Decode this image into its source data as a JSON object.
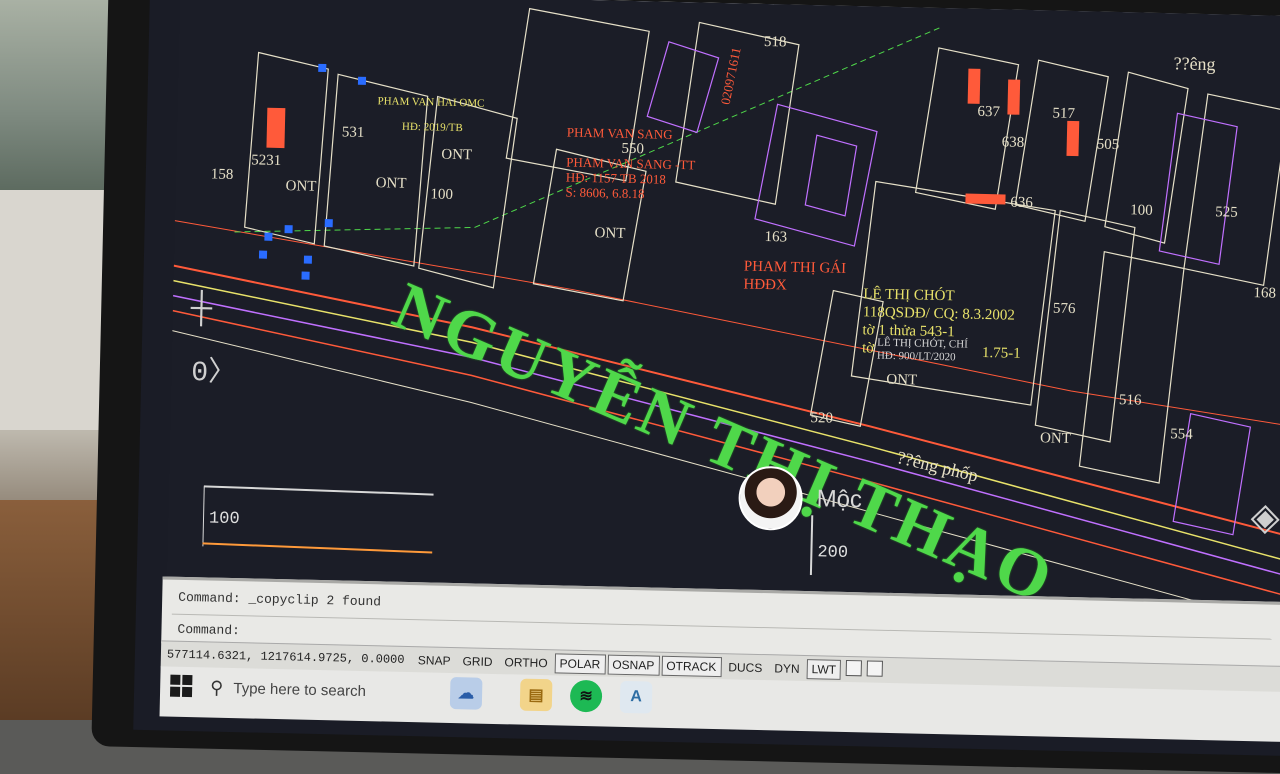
{
  "street_name": "NGUYỄN THỊ THẠO",
  "drawing": {
    "parcels": [
      {
        "id": "p518",
        "text": "518"
      },
      {
        "id": "p531",
        "text": "531"
      },
      {
        "id": "p5231",
        "text": "5231"
      },
      {
        "id": "p158",
        "text": "158"
      },
      {
        "id": "p550",
        "text": "550"
      },
      {
        "id": "p163",
        "text": "163"
      },
      {
        "id": "p576",
        "text": "576"
      },
      {
        "id": "p520",
        "text": "520"
      },
      {
        "id": "p516",
        "text": "516"
      },
      {
        "id": "p554",
        "text": "554"
      },
      {
        "id": "p517",
        "text": "517"
      },
      {
        "id": "p637",
        "text": "637"
      },
      {
        "id": "p638",
        "text": "638"
      },
      {
        "id": "p636",
        "text": "636"
      },
      {
        "id": "p505",
        "text": "505"
      },
      {
        "id": "p525",
        "text": "525"
      },
      {
        "id": "p168",
        "text": "168"
      },
      {
        "id": "p100a",
        "text": "100"
      },
      {
        "id": "p100b",
        "text": "100"
      }
    ],
    "land_use": {
      "ont": "ONT"
    },
    "owners": {
      "pham_van_hai": "PHAM VAN HAI OMC",
      "pham_van_hai_hd": "HĐ: 2019/TB",
      "pham_van_sang_1": "PHAM VAN SANG",
      "pham_van_sang_2": "PHAM VAN SANG -TT",
      "pham_van_sang_hd": "HĐ: 1157 TB 2018",
      "pham_van_sang_date": "S: 8606, 6.8.18",
      "pham_thi_gai": "PHAM THỊ GÁI",
      "pham_thi_gai_2": "HĐĐX",
      "le_thi_chot": "LÊ THỊ CHÓT",
      "le_thi_chot_2": "118QSDĐ/ CQ: 8.3.2002",
      "le_thi_chot_3": "tờ 1 thửa 543-1",
      "le_thi_chot_4": "tờ",
      "le_thi_chot_5": "1.75-1",
      "le_thi_chot_small_1": "LÊ THỊ CHÓT, CHÍ",
      "le_thi_chot_small_2": "HĐ: 900/LT/2020",
      "vertical_1": "020971611",
      "road_top": "??êng",
      "road_mid": "??êng phốp"
    }
  },
  "scale": {
    "left_value": "100",
    "right_value": "200"
  },
  "presenter": {
    "name": "Mộc"
  },
  "command": {
    "line1": "Command: _copyclip 2 found",
    "line2": "Command:"
  },
  "status": {
    "coordinates": "577114.6321, 1217614.9725, 0.0000",
    "toggles": [
      {
        "label": "SNAP",
        "on": false
      },
      {
        "label": "GRID",
        "on": false
      },
      {
        "label": "ORTHO",
        "on": false
      },
      {
        "label": "POLAR",
        "on": true
      },
      {
        "label": "OSNAP",
        "on": true
      },
      {
        "label": "OTRACK",
        "on": true
      },
      {
        "label": "DUCS",
        "on": false
      },
      {
        "label": "DYN",
        "on": false
      },
      {
        "label": "LWT",
        "on": true
      }
    ]
  },
  "taskbar": {
    "search_placeholder": "Type here to search"
  },
  "colors": {
    "street_text": "#4fd84a",
    "canvas_bg": "#1b1d27",
    "parcel_line": "#e6e0c8",
    "boundary_red": "#ff5a3a",
    "boundary_magenta": "#c070ff",
    "grip_blue": "#2a6cff"
  }
}
